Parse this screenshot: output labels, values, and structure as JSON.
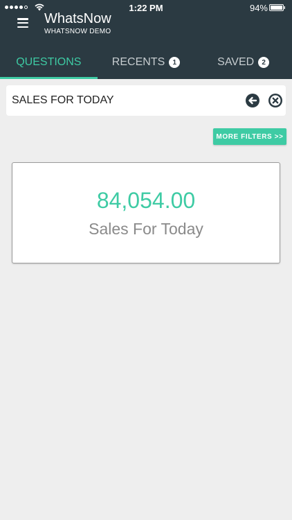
{
  "status_bar": {
    "time": "1:22 PM",
    "battery": "94%"
  },
  "app": {
    "title": "WhatsNow",
    "subtitle": "WHATSNOW DEMO"
  },
  "tabs": [
    {
      "label": "QUESTIONS",
      "active": true
    },
    {
      "label": "RECENTS",
      "badge": "1"
    },
    {
      "label": "SAVED",
      "badge": "2"
    }
  ],
  "question": {
    "text": "SALES FOR TODAY"
  },
  "filters": {
    "more_label": "MORE FILTERS >>"
  },
  "result": {
    "value": "84,054.00",
    "label": "Sales For Today"
  },
  "colors": {
    "header_bg": "#2b3a42",
    "accent": "#3ecba4",
    "page_bg": "#eeeeee"
  },
  "icons": [
    "signal-icon",
    "wifi-icon",
    "battery-icon",
    "menu-icon",
    "back-arrow-icon",
    "clear-icon"
  ]
}
